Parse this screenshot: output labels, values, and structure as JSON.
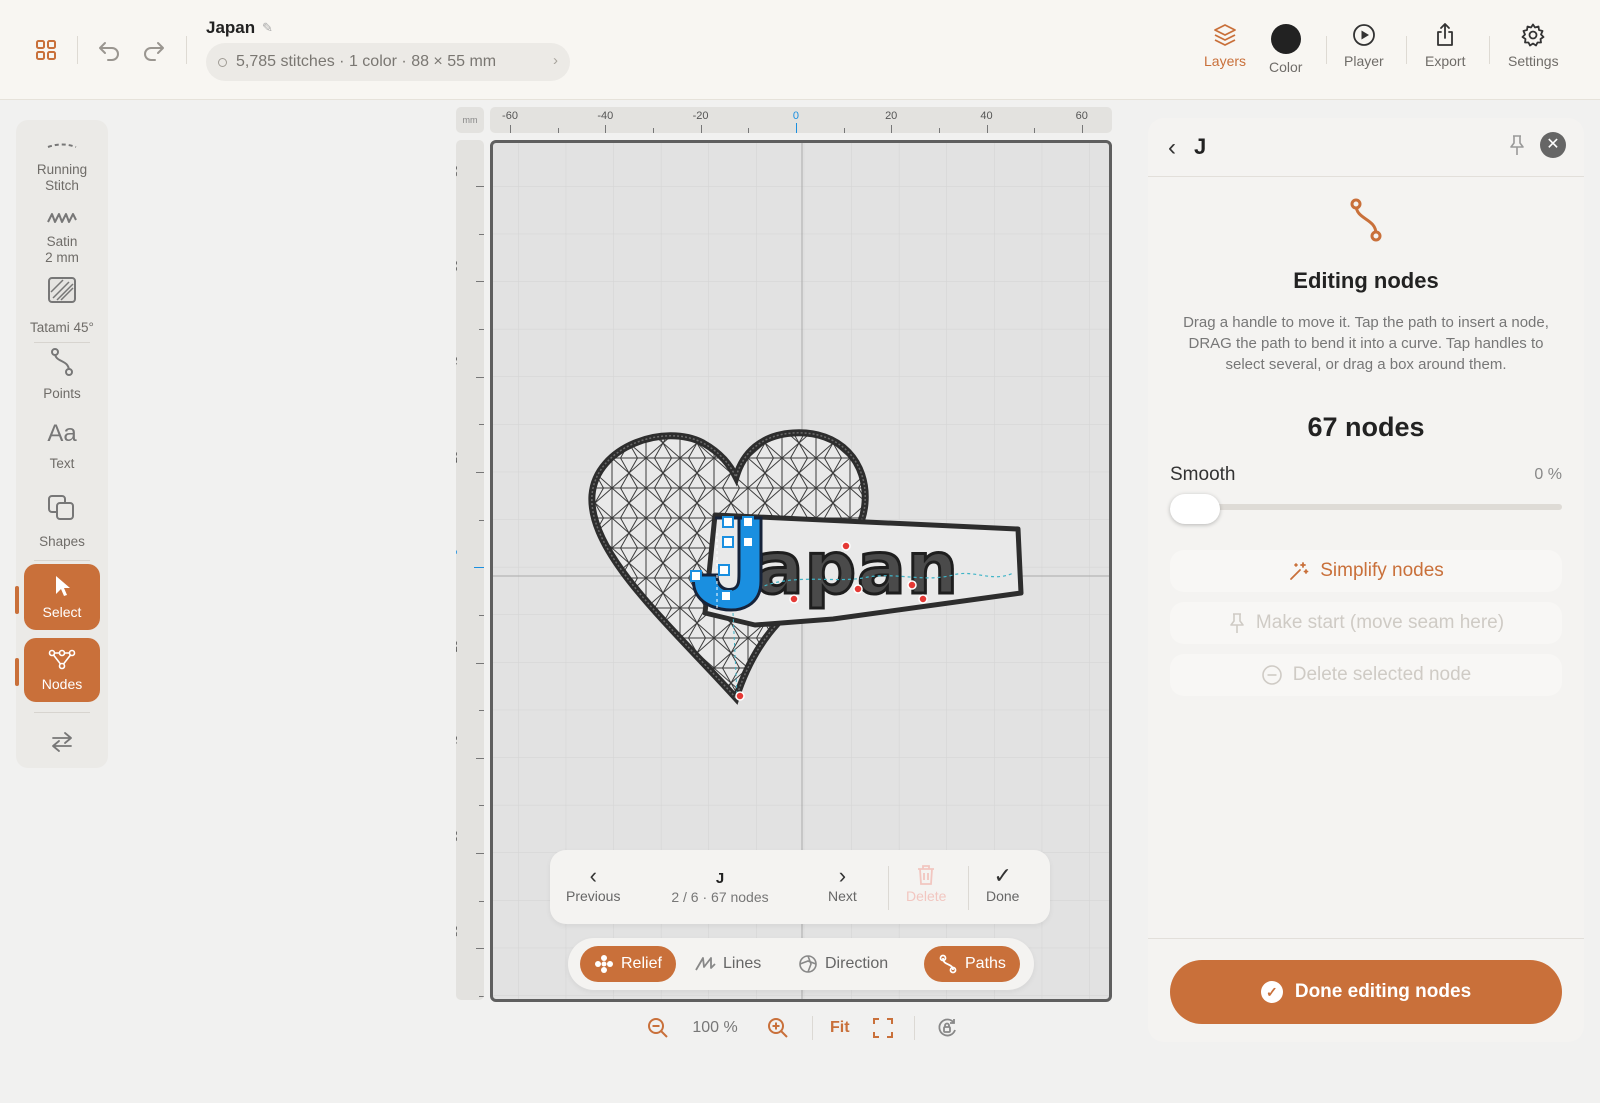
{
  "header": {
    "title": "Japan",
    "info": "5,785 stitches · 1 color · 88 × 55 mm",
    "tools": [
      {
        "label": "Layers",
        "icon": "layers-icon"
      },
      {
        "label": "Color",
        "icon": "color-swatch"
      },
      {
        "label": "Player",
        "icon": "play-icon"
      },
      {
        "label": "Export",
        "icon": "share-icon"
      },
      {
        "label": "Settings",
        "icon": "gear-icon"
      }
    ],
    "color_swatch": "#222222",
    "accent": "#c9703a"
  },
  "sidebar": {
    "stitch_tools": [
      {
        "line1": "Running",
        "line2": "Stitch",
        "icon": "running-stitch-icon"
      },
      {
        "line1": "Satin",
        "line2": "2 mm",
        "icon": "satin-icon"
      },
      {
        "line1": "Tatami 45°",
        "line2": "",
        "icon": "tatami-icon"
      }
    ],
    "draw_tools": [
      {
        "label": "Points",
        "icon": "points-icon"
      },
      {
        "label": "Text",
        "glyph": "Aa"
      },
      {
        "label": "Shapes",
        "icon": "shapes-icon"
      }
    ],
    "select_label": "Select",
    "nodes_label": "Nodes",
    "swap_icon": "swap-icon"
  },
  "canvas": {
    "ruler_unit": "mm",
    "x_ticks": [
      "-60",
      "-40",
      "-20",
      "0",
      "20",
      "40",
      "60"
    ],
    "y_ticks": [
      "80",
      "60",
      "40",
      "20",
      "0",
      "-20",
      "-40",
      "-60",
      "-80"
    ],
    "design_text": "Japan",
    "selected_letter": "J",
    "selection_color": "#1a8fe0"
  },
  "node_nav": {
    "previous_label": "Previous",
    "object_name": "J",
    "position": "2 / 6 · 67 nodes",
    "next_label": "Next",
    "delete_label": "Delete",
    "done_label": "Done"
  },
  "modes": [
    {
      "label": "Relief",
      "active": true
    },
    {
      "label": "Lines",
      "active": false
    },
    {
      "label": "Direction",
      "active": false
    },
    {
      "label": "Paths",
      "active": true
    }
  ],
  "zoom": {
    "value": "100 %",
    "fit_label": "Fit"
  },
  "panel": {
    "title": "J",
    "heading": "Editing nodes",
    "description": "Drag a handle to move it. Tap the path to insert a node, DRAG the path to bend it into a curve. Tap handles to select several, or drag a box around them.",
    "node_count": "67 nodes",
    "smooth_label": "Smooth",
    "smooth_value": "0 %",
    "smooth_fraction": 0,
    "simplify_label": "Simplify nodes",
    "make_start_label": "Make start (move seam here)",
    "delete_node_label": "Delete selected node",
    "done_label": "Done editing nodes"
  }
}
